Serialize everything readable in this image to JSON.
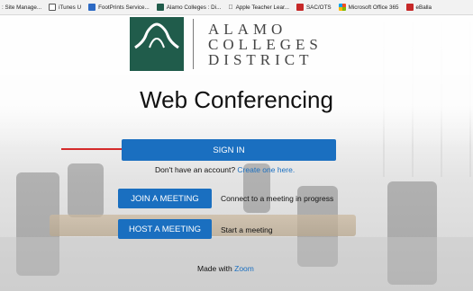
{
  "bookmarks": [
    {
      "label": ": Site Manage...",
      "icon": "none"
    },
    {
      "label": "iTunes U",
      "icon": "outline-square-icon"
    },
    {
      "label": "FootPrints Service...",
      "icon": "footprints-icon",
      "color": "#2d6ac4"
    },
    {
      "label": "Alamo Colleges : Di...",
      "icon": "alamo-icon",
      "color": "#205c4b"
    },
    {
      "label": "Apple Teacher Lear...",
      "icon": "apple-icon"
    },
    {
      "label": "SAC/OTS",
      "icon": "sac-icon",
      "color": "#c62828"
    },
    {
      "label": "Microsoft Office 365",
      "icon": "microsoft-icon"
    },
    {
      "label": "eBalla",
      "icon": "eballot-icon",
      "color": "#c62828"
    }
  ],
  "logo": {
    "line1": "ALAMO",
    "line2": "COLLEGES",
    "line3": "DISTRICT",
    "color": "#205c4b"
  },
  "page_title": "Web Conferencing",
  "signin": {
    "label": "SIGN IN"
  },
  "account": {
    "prompt": "Don't have an account?",
    "link": "Create one here."
  },
  "join": {
    "label": "JOIN A MEETING",
    "desc": "Connect to a meeting in progress"
  },
  "host": {
    "label": "HOST A MEETING",
    "desc": "Start a meeting"
  },
  "footer": {
    "prefix": "Made with",
    "link": "Zoom"
  },
  "accent": "#1a6fc0",
  "annotation_arrow_color": "#d42a2a"
}
